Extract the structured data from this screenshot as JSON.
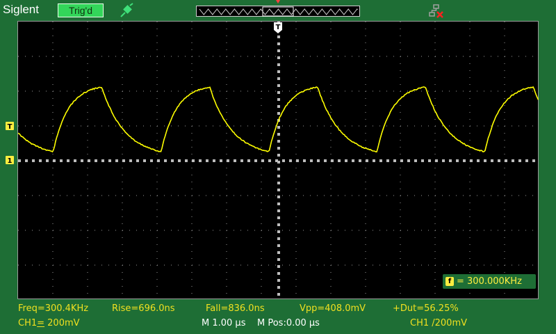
{
  "brand": "Siglent",
  "status": {
    "label": "Trig'd",
    "color": "#33d65a"
  },
  "icons": {
    "probe": "probe-icon",
    "network": "network-disconnected-icon",
    "trigger_time": "trigger-time-marker-icon",
    "trigger_level": "trigger-level-marker-icon",
    "channel_ref": "channel-1-reference-marker-icon"
  },
  "markers": {
    "trigger_time": "T",
    "trigger_level": "T",
    "channel_ref": "1"
  },
  "trace": {
    "color": "#ffff00",
    "channel": "CH1"
  },
  "freq_counter": {
    "badge": "f",
    "text": "= 300.000KHz"
  },
  "measurements": {
    "freq": "Freq=300.4KHz",
    "rise": "Rise=696.0ns",
    "fall": "Fall=836.0ns",
    "vpp": "Vpp=408.0mV",
    "duty": "+Dut=56.25%"
  },
  "bottom": {
    "ch1_label": "CH1",
    "ch1_coupling": "=",
    "ch1_scale": " 200mV",
    "timebase": "M 1.00 µs",
    "mpos": "M Pos:0.00 µs",
    "trigger": "CH1 /200mV"
  },
  "colors": {
    "background": "#1e6e35",
    "text": "#f0e020",
    "screen": "#000000"
  }
}
